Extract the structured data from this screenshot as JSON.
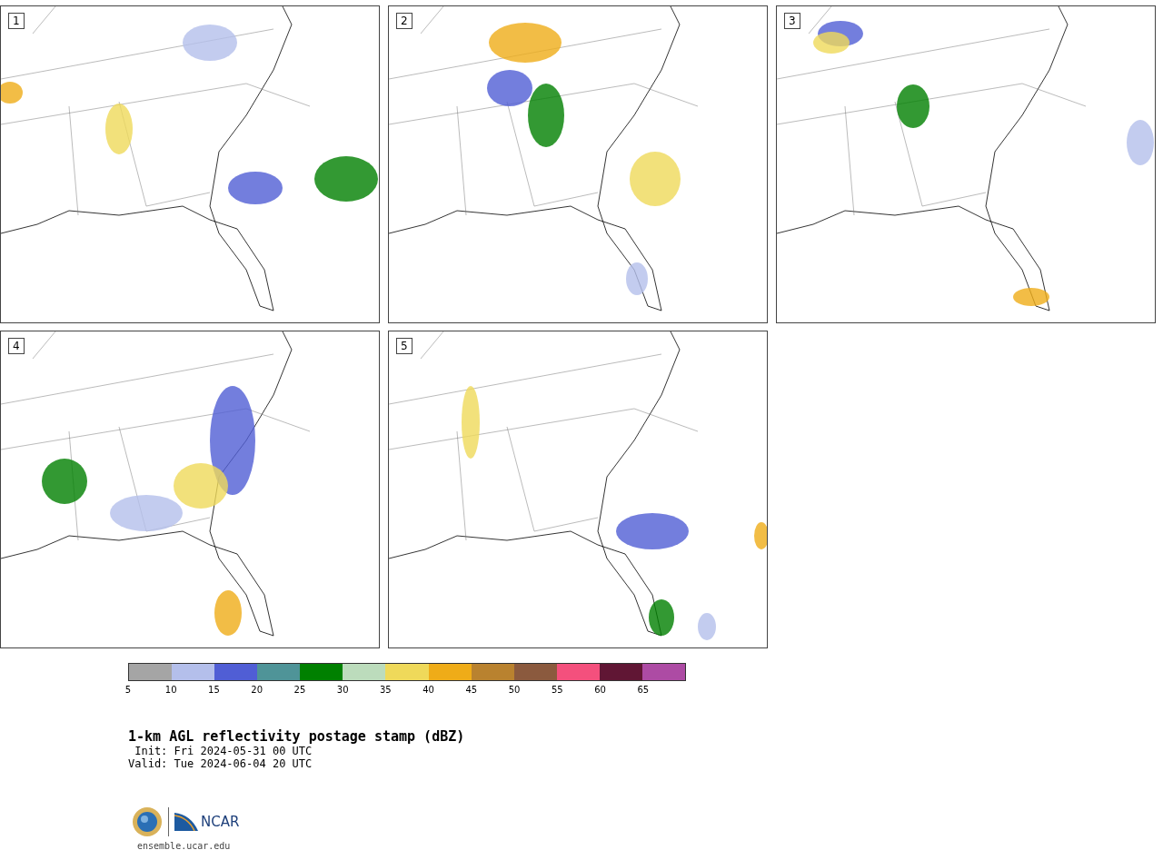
{
  "panels": [
    {
      "number": "1"
    },
    {
      "number": "2"
    },
    {
      "number": "3"
    },
    {
      "number": "4"
    },
    {
      "number": "5"
    }
  ],
  "colorbar": {
    "bins": [
      {
        "color": "#a5a5a5"
      },
      {
        "color": "#b4bfeb"
      },
      {
        "color": "#505ed5"
      },
      {
        "color": "#4f9498"
      },
      {
        "color": "#008000"
      },
      {
        "color": "#bcdcbc"
      },
      {
        "color": "#efd95a"
      },
      {
        "color": "#efac18"
      },
      {
        "color": "#b9822f"
      },
      {
        "color": "#8b5a3e"
      },
      {
        "color": "#f4507d"
      },
      {
        "color": "#601634"
      },
      {
        "color": "#ad4ba4"
      }
    ],
    "ticks": [
      "5",
      "10",
      "15",
      "20",
      "25",
      "30",
      "35",
      "40",
      "45",
      "50",
      "55",
      "60",
      "65"
    ]
  },
  "title": "1-km AGL reflectivity postage stamp (dBZ)",
  "init": " Init: Fri 2024-05-31 00 UTC",
  "valid": "Valid: Tue 2024-06-04 20 UTC",
  "logo": {
    "wordmark": "NCAR"
  },
  "site": "ensemble.ucar.edu"
}
